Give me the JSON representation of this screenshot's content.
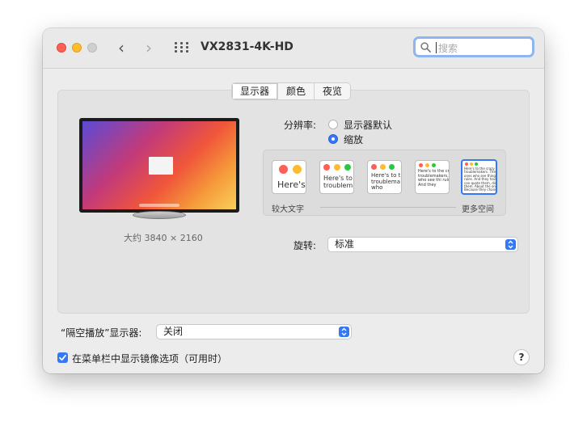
{
  "window": {
    "title": "VX2831-4K-HD",
    "back_glyph": "‹",
    "forward_glyph": "›",
    "search_placeholder": "搜索"
  },
  "tabs": [
    {
      "label": "显示器",
      "active": true
    },
    {
      "label": "颜色",
      "active": false
    },
    {
      "label": "夜览",
      "active": false
    }
  ],
  "display": {
    "resolution_note": "大约 3840 × 2160"
  },
  "resolution": {
    "label": "分辨率:",
    "options": [
      {
        "label": "显示器默认",
        "selected": false
      },
      {
        "label": "缩放",
        "selected": true
      }
    ]
  },
  "scaling": {
    "sample_text": [
      "Here's",
      "Here's to t troublem",
      "Here's to t troublema ones who",
      "Here's to the cr troublemakers. ones who see thi rules. And they",
      "Here's to the crazy one troublemakers. The rou ones who see things diff rules. And they have no can quote them, disagre them. About the only th Because they change th"
    ],
    "min_label": "较大文字",
    "max_label": "更多空间",
    "selected_index": 4
  },
  "rotation": {
    "label": "旋转:",
    "value": "标准"
  },
  "airplay": {
    "label": "“隔空播放”显示器:",
    "value": "关闭"
  },
  "mirroring": {
    "label": "在菜单栏中显示镜像选项（可用时）",
    "checked": true
  },
  "help": {
    "glyph": "?"
  },
  "colors": {
    "accent": "#3478f6",
    "close": "#fe5f57",
    "minimize": "#febc2e",
    "zoom_disabled": "#cfcfcf"
  }
}
